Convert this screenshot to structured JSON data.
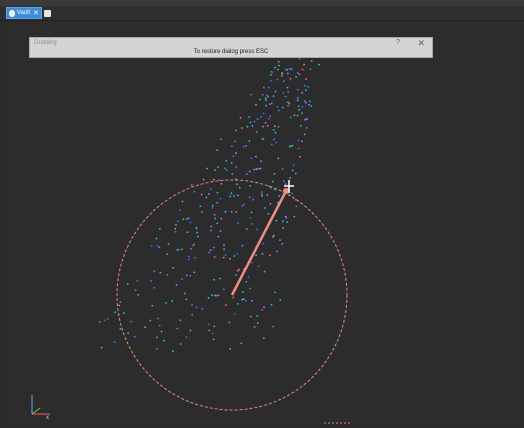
{
  "tab": {
    "label": "Vault",
    "close": "✕"
  },
  "dialog": {
    "title": "Gridding",
    "hint": "To restore dialog press ESC",
    "help": "?",
    "close": "✕"
  },
  "colors": {
    "circle": "#e88a80",
    "radius_line": "#f08c86",
    "points": [
      "#3a8cff",
      "#2ec8b6",
      "#3a6dff",
      "#8a5cff",
      "#27d39a",
      "#ff6a7a",
      "#c86cff",
      "#39b6ff"
    ]
  },
  "axis_icons": [
    "x-axis-icon",
    "y-axis-icon",
    "z-axis-icon"
  ]
}
